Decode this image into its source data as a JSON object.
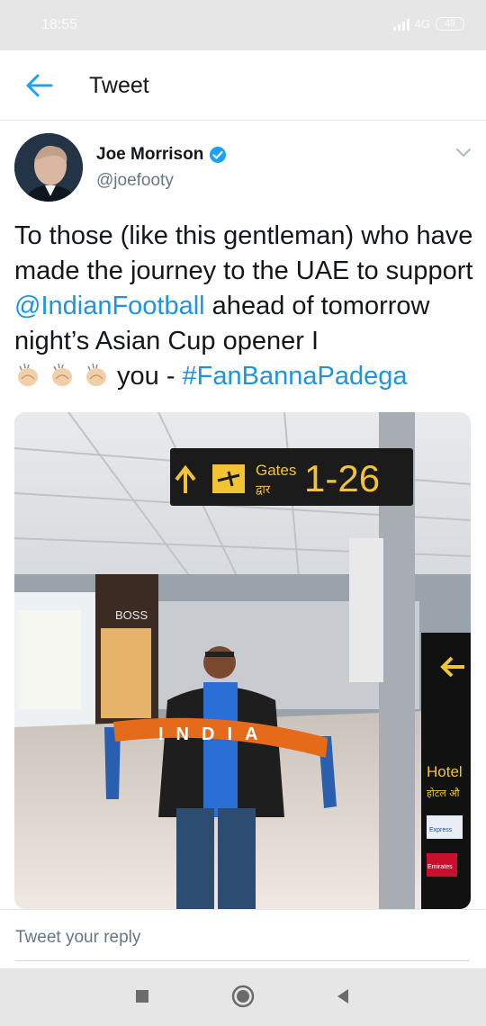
{
  "status_bar": {
    "time": "18:55",
    "network": "4G",
    "battery": "49"
  },
  "header": {
    "title": "Tweet"
  },
  "tweet": {
    "author_name": "Joe Morrison",
    "handle": "@joefooty",
    "text_part1": "To those (like this gentleman) who have made the journey to the UAE to support ",
    "mention": "@IndianFootball",
    "text_part2": " ahead of tomorrow night’s Asian Cup opener I ",
    "text_part3": "you - ",
    "hashtag": "#FanBannaPadega",
    "photo": {
      "sign_gates_en": "Gates",
      "sign_gates_hi": "द्वार",
      "sign_range": "1-26",
      "scarf_text": "INDIA",
      "store_sign": "BOSS",
      "side_sign_title": "Hotel",
      "side_sign_hi": "होटल औ",
      "side_sign_brand1": "Express",
      "side_sign_brand2": "Emirates"
    }
  },
  "reply": {
    "placeholder": "Tweet your reply"
  },
  "colors": {
    "link": "#1b95e0",
    "verified": "#1da1f2",
    "secondary_text": "#657786"
  }
}
